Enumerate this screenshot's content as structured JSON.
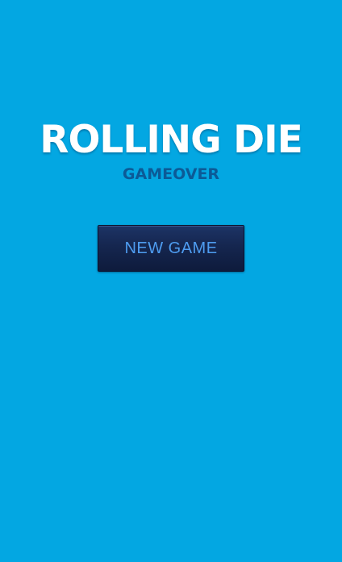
{
  "game": {
    "title": "ROLLING DIE",
    "status": "GAMEOVER",
    "new_game_label": "NEW GAME"
  },
  "colors": {
    "background": "#03a7e2",
    "title": "#ffffff",
    "status": "#0c5a96",
    "button_bg": "#15264f",
    "button_text": "#4e9cf0"
  }
}
